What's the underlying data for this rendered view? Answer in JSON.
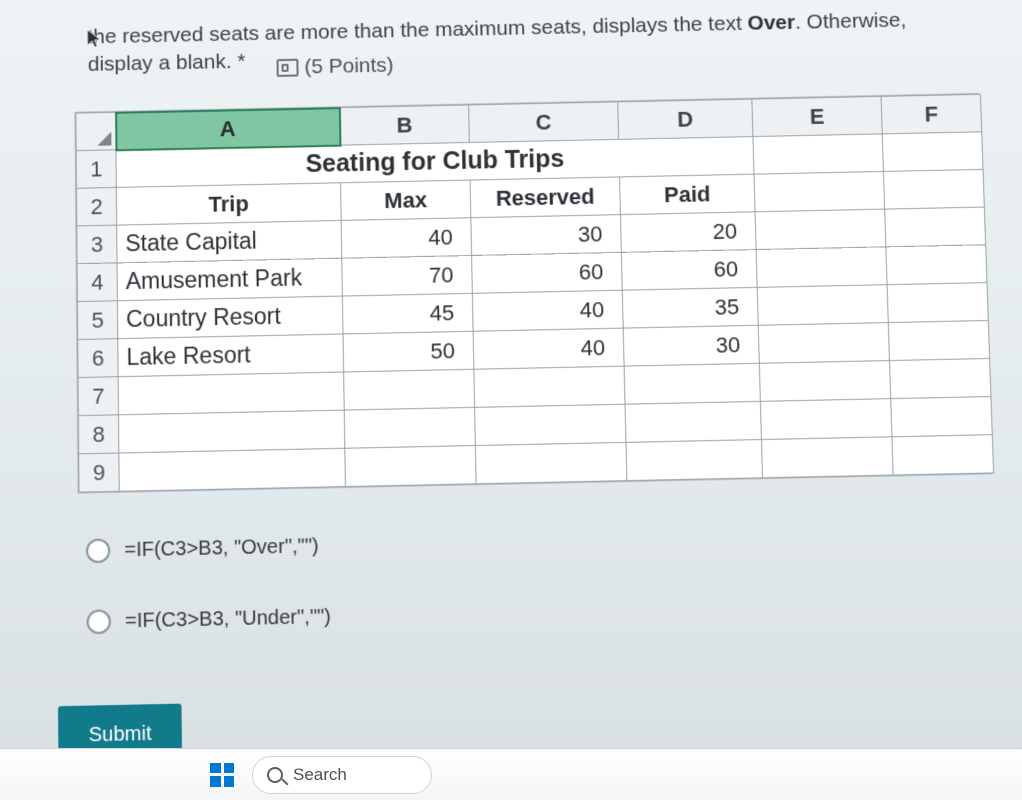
{
  "question": {
    "line1": "the reserved seats are more than the maximum seats, displays the text",
    "bold_word": "Over",
    "line1_tail": ". Otherwise,",
    "line2_pre": "display a blank. *",
    "points": "(5 Points)"
  },
  "sheet": {
    "columns": [
      "A",
      "B",
      "C",
      "D",
      "E",
      "F"
    ],
    "row_numbers": [
      "1",
      "2",
      "3",
      "4",
      "5",
      "6",
      "7",
      "8",
      "9"
    ],
    "title": "Seating for Club Trips",
    "headers": {
      "a": "Trip",
      "b": "Max",
      "c": "Reserved",
      "d": "Paid"
    },
    "rows": [
      {
        "a": "State Capital",
        "b": "40",
        "c": "30",
        "d": "20"
      },
      {
        "a": "Amusement Park",
        "b": "70",
        "c": "60",
        "d": "60"
      },
      {
        "a": "Country Resort",
        "b": "45",
        "c": "40",
        "d": "35"
      },
      {
        "a": "Lake Resort",
        "b": "50",
        "c": "40",
        "d": "30"
      }
    ]
  },
  "options": [
    "=IF(C3>B3, \"Over\",\"\")",
    "=IF(C3>B3, \"Under\",\"\")"
  ],
  "submit_label": "Submit",
  "taskbar": {
    "search_placeholder": "Search"
  }
}
